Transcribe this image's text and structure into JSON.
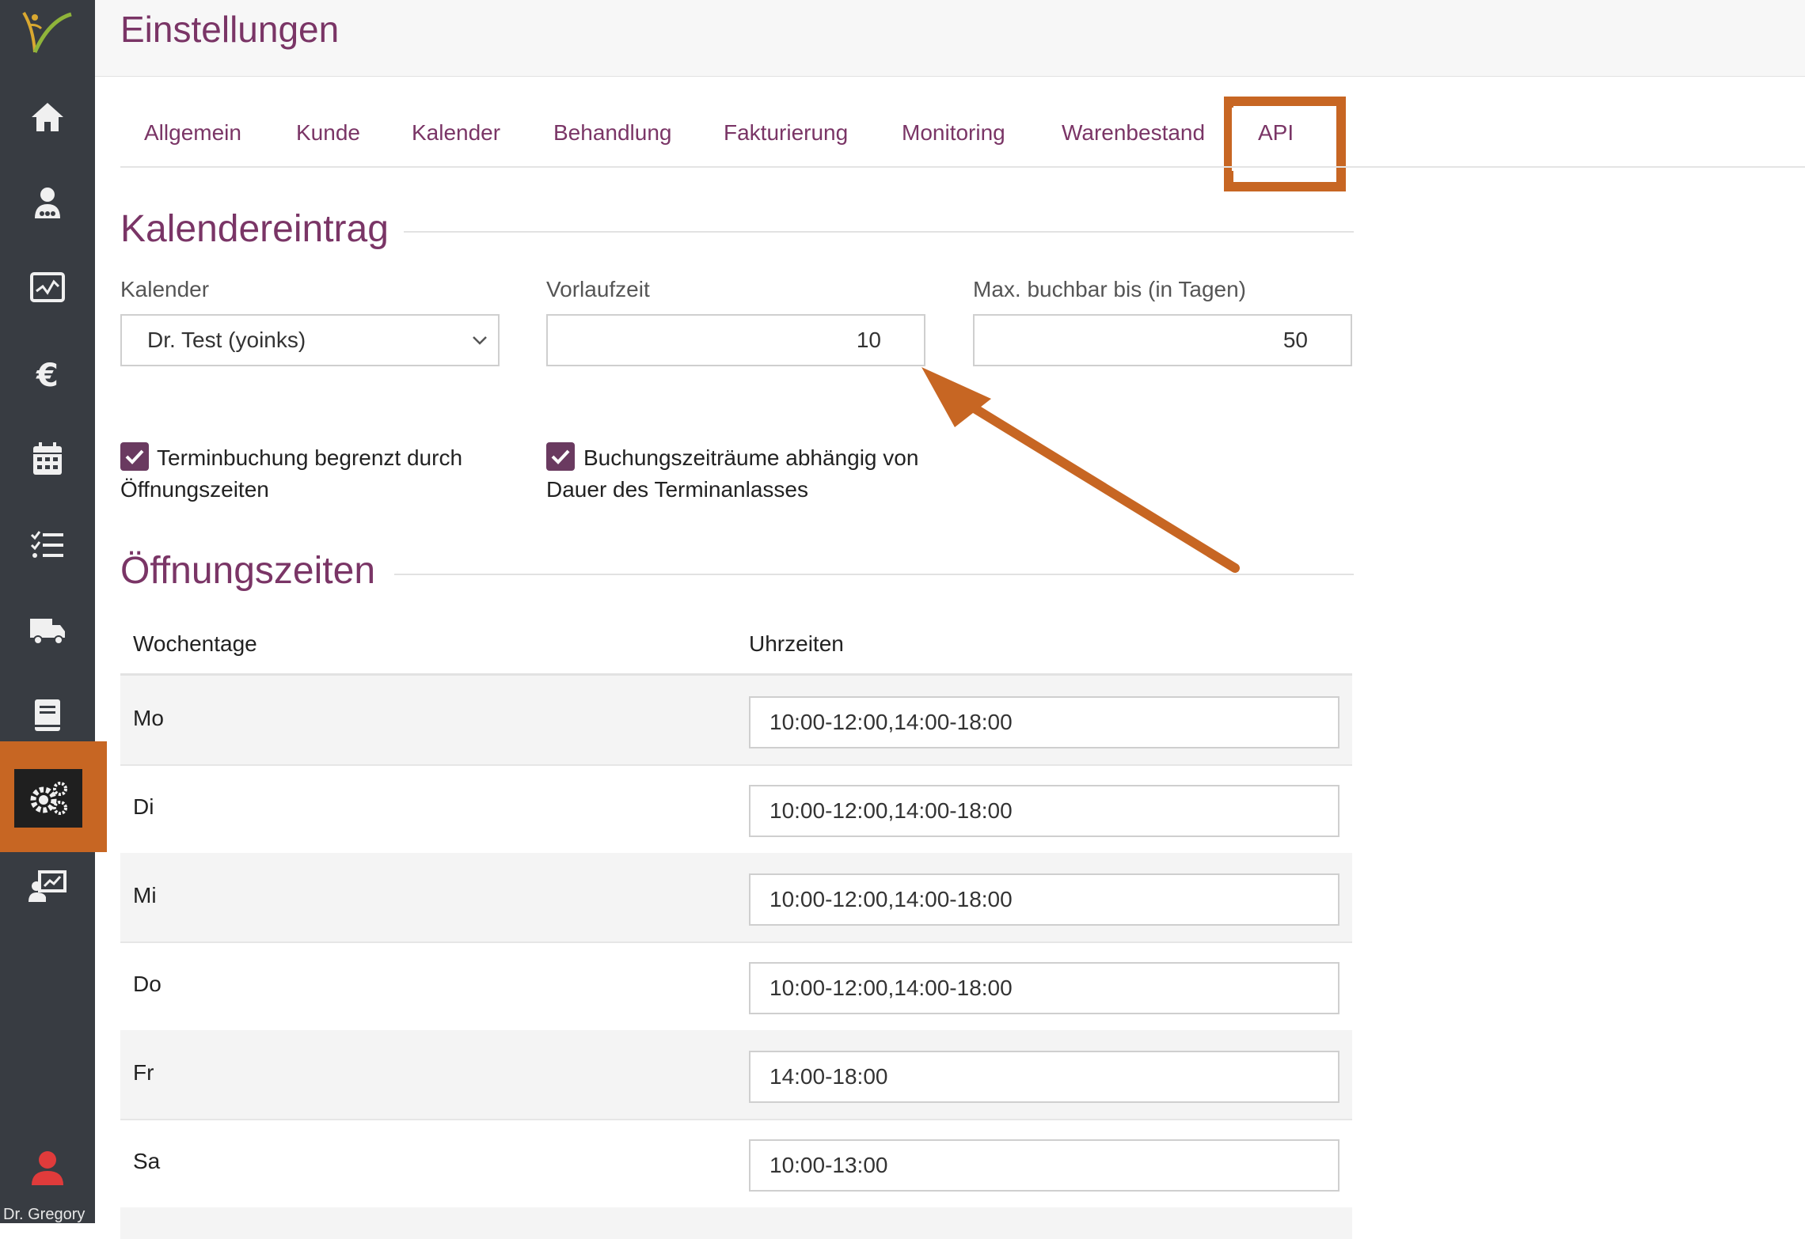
{
  "app": {
    "user_name": "Dr. Gregory"
  },
  "sidebar": {
    "items": [
      {
        "icon": "home-icon"
      },
      {
        "icon": "doctor-icon"
      },
      {
        "icon": "monitor-chart-icon"
      },
      {
        "icon": "euro-icon"
      },
      {
        "icon": "calendar-icon"
      },
      {
        "icon": "task-list-icon"
      },
      {
        "icon": "truck-icon"
      },
      {
        "icon": "book-icon"
      },
      {
        "icon": "settings-gears-icon",
        "active": true
      },
      {
        "icon": "presentation-icon"
      }
    ],
    "accent_color": "#c76623",
    "background": "#383c42"
  },
  "header": {
    "title": "Einstellungen"
  },
  "tabs": [
    {
      "label": "Allgemein"
    },
    {
      "label": "Kunde"
    },
    {
      "label": "Kalender"
    },
    {
      "label": "Behandlung"
    },
    {
      "label": "Fakturierung"
    },
    {
      "label": "Monitoring"
    },
    {
      "label": "Warenbestand"
    },
    {
      "label": "API",
      "highlighted": true
    }
  ],
  "kalendereintrag": {
    "title": "Kalendereintrag",
    "kalender_label": "Kalender",
    "kalender_value": "Dr. Test (yoinks)",
    "vorlaufzeit_label": "Vorlaufzeit",
    "vorlaufzeit_value": "10",
    "max_label": "Max. buchbar bis (in Tagen)",
    "max_value": "50",
    "checkbox1_line1": "Terminbuchung begrenzt durch",
    "checkbox1_line2": "Öffnungszeiten",
    "checkbox1_checked": true,
    "checkbox2_line1": "Buchungszeiträume abhängig von",
    "checkbox2_line2": "Dauer des Terminanlasses",
    "checkbox2_checked": true
  },
  "oeffnungszeiten": {
    "title": "Öffnungszeiten",
    "col_days": "Wochentage",
    "col_times": "Uhrzeiten",
    "rows": [
      {
        "day": "Mo",
        "times": "10:00-12:00,14:00-18:00"
      },
      {
        "day": "Di",
        "times": "10:00-12:00,14:00-18:00"
      },
      {
        "day": "Mi",
        "times": "10:00-12:00,14:00-18:00"
      },
      {
        "day": "Do",
        "times": "10:00-12:00,14:00-18:00"
      },
      {
        "day": "Fr",
        "times": "14:00-18:00"
      },
      {
        "day": "Sa",
        "times": "10:00-13:00"
      }
    ]
  },
  "colors": {
    "brand_purple": "#7a3566",
    "highlight_orange": "#c76623"
  }
}
